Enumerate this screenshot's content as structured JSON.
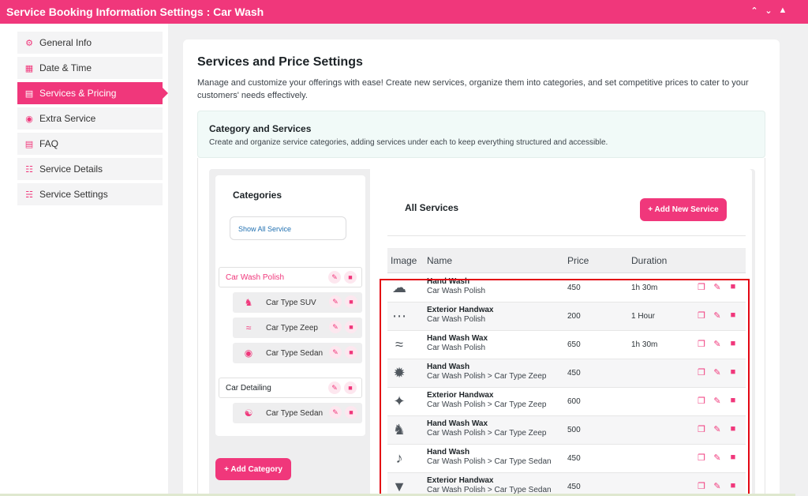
{
  "window": {
    "title": "Service Booking Information Settings : Car Wash",
    "controls": [
      "chevron-up",
      "chevron-down",
      "triangle-up"
    ]
  },
  "sidebar": {
    "items": [
      {
        "label": "General Info",
        "icon": "gear-icon",
        "active": false
      },
      {
        "label": "Date & Time",
        "icon": "calendar-icon",
        "active": false
      },
      {
        "label": "Services & Pricing",
        "icon": "price-tag-icon",
        "active": true
      },
      {
        "label": "Extra Service",
        "icon": "gift-icon",
        "active": false
      },
      {
        "label": "FAQ",
        "icon": "faq-icon",
        "active": false
      },
      {
        "label": "Service Details",
        "icon": "list-icon",
        "active": false
      },
      {
        "label": "Service Settings",
        "icon": "sitemap-icon",
        "active": false
      }
    ]
  },
  "main": {
    "title": "Services and Price Settings",
    "description": "Manage and customize your offerings with ease! Create new services, organize them into categories, and set competitive prices to cater to your customers' needs effectively.",
    "category_section": {
      "title": "Category and Services",
      "description": "Create and organize service categories, adding services under each to keep everything structured and accessible."
    }
  },
  "categories": {
    "title": "Categories",
    "show_all": "Show All Service",
    "groups": [
      {
        "name": "Car Wash Polish",
        "selected": true,
        "subcategories": [
          {
            "name": "Car Type SUV",
            "icon": "dog-icon"
          },
          {
            "name": "Car Type Zeep",
            "icon": "water-icon"
          },
          {
            "name": "Car Type Sedan",
            "icon": "car-icon"
          }
        ]
      },
      {
        "name": "Car Detailing",
        "selected": false,
        "subcategories": [
          {
            "name": "Car Type Sedan",
            "icon": "spiral-icon"
          }
        ]
      }
    ],
    "add_button": "+ Add Category"
  },
  "services": {
    "title": "All Services",
    "add_button": "+ Add New Service",
    "columns": {
      "image": "Image",
      "name": "Name",
      "price": "Price",
      "duration": "Duration"
    },
    "rows": [
      {
        "icon": "frog-icon",
        "name": "Hand Wash",
        "category": "Car Wash Polish",
        "price": "450",
        "duration": "1h 30m"
      },
      {
        "icon": "paw-icon",
        "name": "Exterior Handwax",
        "category": "Car Wash Polish",
        "price": "200",
        "duration": "1 Hour"
      },
      {
        "icon": "water-icon",
        "name": "Hand Wash Wax",
        "category": "Car Wash Polish",
        "price": "650",
        "duration": "1h 30m"
      },
      {
        "icon": "spider-icon",
        "name": "Hand Wash",
        "category": "Car Wash Polish > Car Type Zeep",
        "price": "450",
        "duration": ""
      },
      {
        "icon": "crow-icon",
        "name": "Exterior Handwax",
        "category": "Car Wash Polish > Car Type Zeep",
        "price": "600",
        "duration": ""
      },
      {
        "icon": "dog-icon",
        "name": "Hand Wash Wax",
        "category": "Car Wash Polish > Car Type Zeep",
        "price": "500",
        "duration": ""
      },
      {
        "icon": "microphone-icon",
        "name": "Hand Wash",
        "category": "Car Wash Polish > Car Type Sedan",
        "price": "450",
        "duration": ""
      },
      {
        "icon": "cocktail-icon",
        "name": "Exterior Handwax",
        "category": "Car Wash Polish > Car Type Sedan",
        "price": "450",
        "duration": ""
      }
    ],
    "row_actions": [
      "copy-icon",
      "edit-icon",
      "trash-icon"
    ]
  },
  "colors": {
    "accent": "#f0377b",
    "highlight": "#e30613"
  }
}
